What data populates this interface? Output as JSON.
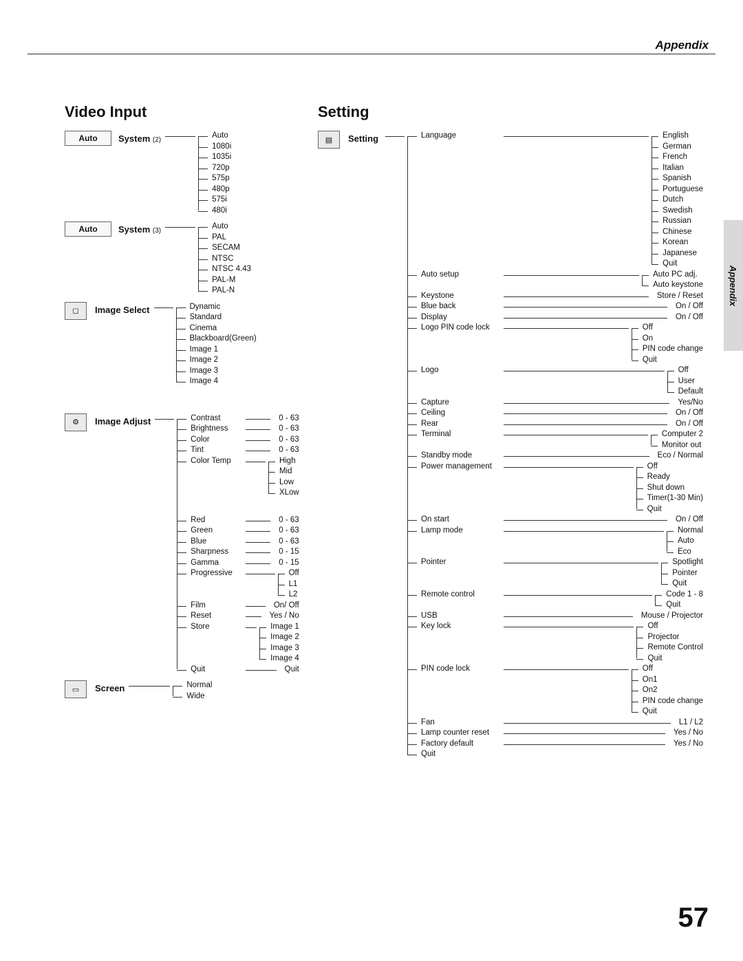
{
  "page": {
    "header": "Appendix",
    "sideTab": "Appendix",
    "number": "57"
  },
  "left": {
    "title": "Video Input",
    "autoLabel": "Auto",
    "system2": {
      "label": "System",
      "note": "(2)",
      "items": [
        "Auto",
        "1080i",
        "1035i",
        "720p",
        "575p",
        "480p",
        "575i",
        "480i"
      ]
    },
    "system3": {
      "label": "System",
      "note": "(3)",
      "items": [
        "Auto",
        "PAL",
        "SECAM",
        "NTSC",
        "NTSC 4.43",
        "PAL-M",
        "PAL-N"
      ]
    },
    "imageSelect": {
      "label": "Image Select",
      "items": [
        "Dynamic",
        "Standard",
        "Cinema",
        "Blackboard(Green)",
        "Image 1",
        "Image 2",
        "Image 3",
        "Image 4"
      ]
    },
    "imageAdjust": {
      "label": "Image Adjust",
      "rows": [
        {
          "k": "Contrast",
          "vals": [
            "0 - 63"
          ]
        },
        {
          "k": "Brightness",
          "vals": [
            "0 - 63"
          ]
        },
        {
          "k": "Color",
          "vals": [
            "0 - 63"
          ]
        },
        {
          "k": "Tint",
          "vals": [
            "0 - 63"
          ]
        },
        {
          "k": "Color Temp",
          "vals": [
            "High",
            "Mid",
            "Low",
            "XLow"
          ]
        }
      ],
      "rows2": [
        {
          "k": "Red",
          "vals": [
            "0 - 63"
          ]
        },
        {
          "k": "Green",
          "vals": [
            "0 - 63"
          ]
        },
        {
          "k": "Blue",
          "vals": [
            "0 - 63"
          ]
        },
        {
          "k": "Sharpness",
          "vals": [
            "0 - 15"
          ]
        },
        {
          "k": "Gamma",
          "vals": [
            "0 - 15"
          ]
        },
        {
          "k": "Progressive",
          "vals": [
            "Off",
            "L1",
            "L2"
          ]
        },
        {
          "k": "Film",
          "vals": [
            "On/ Off"
          ]
        },
        {
          "k": "Reset",
          "vals": [
            "Yes / No"
          ]
        },
        {
          "k": "Store",
          "vals": [
            "Image 1",
            "Image 2",
            "Image 3",
            "Image 4"
          ]
        },
        {
          "k": "Quit",
          "vals": [
            "Quit"
          ]
        }
      ]
    },
    "screen": {
      "label": "Screen",
      "items": [
        "Normal",
        "Wide"
      ]
    }
  },
  "right": {
    "title": "Setting",
    "label": "Setting",
    "rows": [
      {
        "k": "Language",
        "vals": [
          "English",
          "German",
          "French",
          "Italian",
          "Spanish",
          "Portuguese",
          "Dutch",
          "Swedish",
          "Russian",
          "Chinese",
          "Korean",
          "Japanese",
          "Quit"
        ]
      },
      {
        "k": "Auto setup",
        "vals": [
          "Auto PC adj.",
          "Auto keystone"
        ]
      },
      {
        "k": "Keystone",
        "vals": [
          "Store / Reset"
        ]
      },
      {
        "k": "Blue back",
        "vals": [
          "On / Off"
        ]
      },
      {
        "k": "Display",
        "vals": [
          "On / Off"
        ]
      },
      {
        "k": "Logo PIN code lock",
        "vals": [
          "Off",
          "On",
          "PIN code change",
          "Quit"
        ]
      },
      {
        "k": "Logo",
        "vals": [
          "Off",
          "User",
          "Default"
        ]
      },
      {
        "k": "Capture",
        "vals": [
          "Yes/No"
        ]
      },
      {
        "k": "Ceiling",
        "vals": [
          "On / Off"
        ]
      },
      {
        "k": "Rear",
        "vals": [
          "On / Off"
        ]
      },
      {
        "k": "Terminal",
        "vals": [
          "Computer 2",
          "Monitor out"
        ]
      },
      {
        "k": "Standby mode",
        "vals": [
          "Eco / Normal"
        ]
      },
      {
        "k": "Power management",
        "vals": [
          "Off",
          "Ready",
          "Shut down",
          "Timer(1-30 Min)",
          "Quit"
        ]
      },
      {
        "k": "On start",
        "vals": [
          "On / Off"
        ]
      },
      {
        "k": "Lamp mode",
        "vals": [
          "Normal",
          "Auto",
          "Eco"
        ]
      },
      {
        "k": "Pointer",
        "vals": [
          "Spotlight",
          "Pointer",
          "Quit"
        ]
      },
      {
        "k": "Remote control",
        "vals": [
          "Code 1 - 8",
          "Quit"
        ]
      },
      {
        "k": "USB",
        "vals": [
          "Mouse / Projector"
        ]
      },
      {
        "k": "Key lock",
        "vals": [
          "Off",
          "Projector",
          "Remote Control",
          "Quit"
        ]
      },
      {
        "k": "PIN code lock",
        "vals": [
          "Off",
          "On1",
          "On2",
          "PIN code change",
          "Quit"
        ]
      },
      {
        "k": "Fan",
        "vals": [
          "L1 / L2"
        ]
      },
      {
        "k": "Lamp counter reset",
        "vals": [
          "Yes / No"
        ]
      },
      {
        "k": "Factory default",
        "vals": [
          "Yes / No"
        ]
      },
      {
        "k": "Quit",
        "vals": []
      }
    ]
  }
}
